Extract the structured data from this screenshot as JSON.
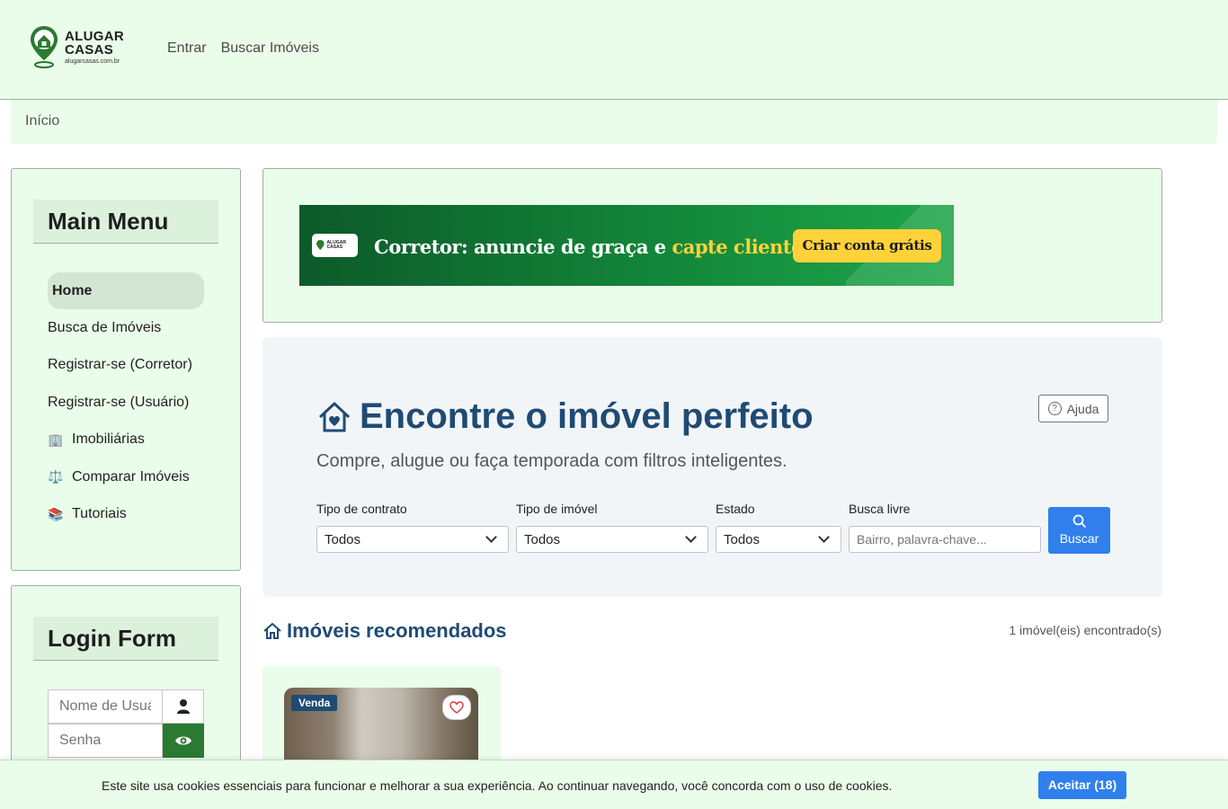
{
  "header": {
    "logo_line1": "ALUGAR",
    "logo_line2": "CASAS",
    "logo_domain": "alugarcasas.com.br",
    "nav": [
      "Entrar",
      "Buscar Imóveis"
    ]
  },
  "breadcrumb": "Início",
  "sidebar": {
    "menu_title": "Main Menu",
    "items": [
      {
        "label": "Home",
        "icon": ""
      },
      {
        "label": "Busca de Imóveis",
        "icon": ""
      },
      {
        "label": "Registrar-se (Corretor)",
        "icon": ""
      },
      {
        "label": "Registrar-se (Usuário)",
        "icon": ""
      },
      {
        "label": "Imobiliárias",
        "icon": "🏢"
      },
      {
        "label": "Comparar Imóveis",
        "icon": "⚖️"
      },
      {
        "label": "Tutoriais",
        "icon": "📚"
      }
    ],
    "login_title": "Login Form",
    "username_placeholder": "Nome de Usuário",
    "password_placeholder": "Senha"
  },
  "banner": {
    "text_main": "Corretor: anuncie de graça e ",
    "text_highlight": "capte clientes.",
    "cta": "Criar conta grátis",
    "logo_text": "ALUGAR CASAS"
  },
  "search": {
    "help_label": "Ajuda",
    "title": "Encontre o imóvel perfeito",
    "subtitle": "Compre, alugue ou faça temporada com filtros inteligentes.",
    "contract_label": "Tipo de contrato",
    "contract_value": "Todos",
    "type_label": "Tipo de imóvel",
    "type_value": "Todos",
    "state_label": "Estado",
    "state_value": "Todos",
    "free_label": "Busca livre",
    "free_placeholder": "Bairro, palavra-chave...",
    "button_label": "Buscar"
  },
  "recommended": {
    "title": "Imóveis recomendados",
    "count": "1 imóvel(eis) encontrado(s)",
    "cards": [
      {
        "badge": "Venda"
      }
    ]
  },
  "cookie": {
    "text": "Este site usa cookies essenciais para funcionar e melhorar a sua experiência. Ao continuar navegando, você concorda com o uso de cookies.",
    "button": "Aceitar (18)"
  },
  "colors": {
    "header_bg": "#eafdea",
    "primary_blue": "#2f80ed",
    "title_blue": "#1f4b73",
    "brand_green": "#2b7a34"
  }
}
